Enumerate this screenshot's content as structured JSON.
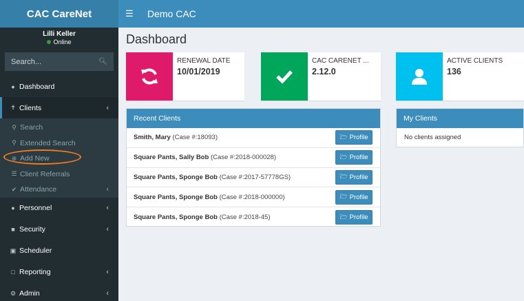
{
  "brand": "CAC CareNet",
  "header": {
    "title": "Demo CAC"
  },
  "user": {
    "name": "Lilli Keller",
    "status": "Online"
  },
  "search": {
    "placeholder": "Search..."
  },
  "menu": {
    "dashboard": "Dashboard",
    "clients": "Clients",
    "clients_sub": {
      "search": "Search",
      "extended_search": "Extended Search",
      "add_new": "Add New",
      "client_referrals": "Client Referrals",
      "attendance": "Attendance"
    },
    "personnel": "Personnel",
    "security": "Security",
    "scheduler": "Scheduler",
    "reporting": "Reporting",
    "admin": "Admin"
  },
  "page": {
    "title": "Dashboard"
  },
  "infoboxes": [
    {
      "label": "RENEWAL DATE",
      "value": "10/01/2019",
      "color": "#e01a6b",
      "icon": "refresh-icon"
    },
    {
      "label": "CAC CARENET ...",
      "value": "2.12.0",
      "color": "#00a65a",
      "icon": "check-icon"
    },
    {
      "label": "ACTIVE CLIENTS",
      "value": "136",
      "color": "#00c0ef",
      "icon": "user-icon"
    }
  ],
  "recent_clients": {
    "title": "Recent Clients",
    "button_label": "Profile",
    "rows": [
      {
        "name": "Smith, Mary",
        "case": "(Case #:18093)"
      },
      {
        "name": "Square Pants, Sally Bob",
        "case": "(Case #:2018-000028)"
      },
      {
        "name": "Square Pants, Sponge Bob",
        "case": "(Case #:2017-57778GS)"
      },
      {
        "name": "Square Pants, Sponge Bob",
        "case": "(Case #:2018-000000)"
      },
      {
        "name": "Square Pants, Sponge Bob",
        "case": "(Case #:2018-45)"
      }
    ]
  },
  "my_clients": {
    "title": "My Clients",
    "empty_text": "No clients assigned"
  },
  "colors": {
    "primary": "#3c8dbc",
    "sidebar": "#222d32",
    "highlight": "#f47b20"
  }
}
